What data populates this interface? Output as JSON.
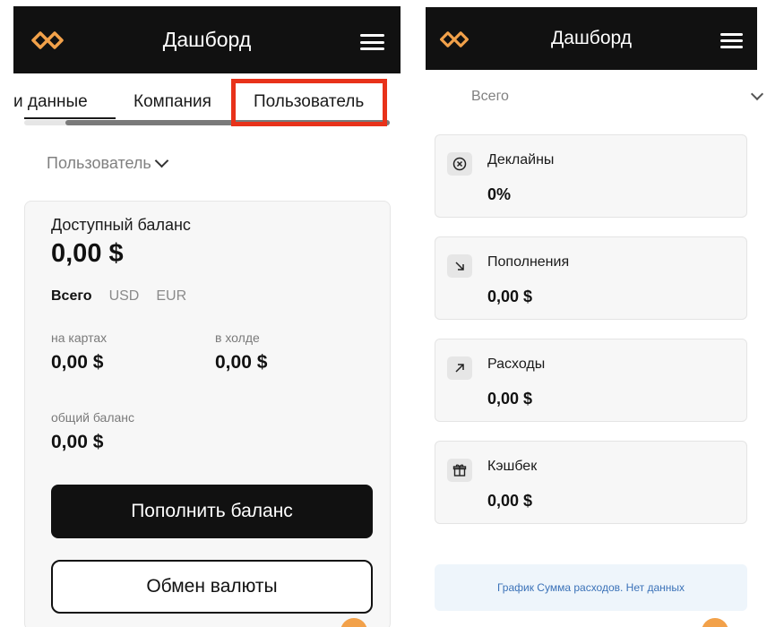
{
  "header": {
    "title": "Дашборд"
  },
  "left": {
    "tabs": [
      {
        "label": "и данные"
      },
      {
        "label": "Компания"
      },
      {
        "label": "Пользователь"
      }
    ],
    "filter": {
      "value": "Пользователь"
    },
    "balance_card": {
      "title": "Доступный баланс",
      "amount": "0,00 $",
      "currency_tabs": [
        {
          "label": "Всего",
          "active": true
        },
        {
          "label": "USD",
          "active": false
        },
        {
          "label": "EUR",
          "active": false
        }
      ],
      "on_cards": {
        "label": "на картах",
        "value": "0,00 $"
      },
      "on_hold": {
        "label": "в холде",
        "value": "0,00 $"
      },
      "total": {
        "label": "общий баланс",
        "value": "0,00 $"
      },
      "topup_button": "Пополнить баланс",
      "exchange_button": "Обмен валюты"
    }
  },
  "right": {
    "filter": {
      "value": "Всего"
    },
    "stats": [
      {
        "icon": "declined-icon",
        "glyph": "⊗",
        "label": "Деклайны",
        "value": "0%"
      },
      {
        "icon": "arrow-down-right-icon",
        "glyph": "↘",
        "label": "Пополнения",
        "value": "0,00 $"
      },
      {
        "icon": "arrow-up-right-icon",
        "glyph": "↗",
        "label": "Расходы",
        "value": "0,00 $"
      },
      {
        "icon": "gift-icon",
        "glyph": "",
        "label": "Кэшбек",
        "value": "0,00 $"
      }
    ],
    "chart_empty_text": "График Сумма расходов. Нет данных"
  },
  "colors": {
    "header_bg": "#111111",
    "logo": "#f2a14a",
    "highlight": "#e8321a",
    "primary_button": "#111111",
    "chart_empty_bg": "#eef5fb",
    "chart_empty_text": "#3b72b8"
  }
}
